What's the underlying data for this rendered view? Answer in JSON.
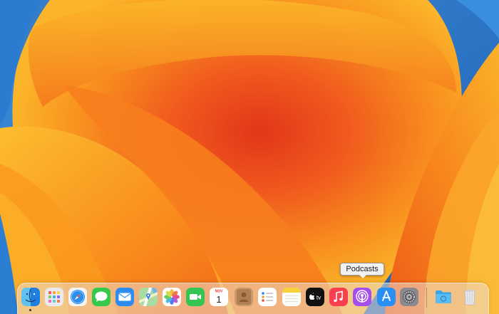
{
  "tooltip": {
    "text": "Podcasts"
  },
  "dock": {
    "apps": [
      {
        "name": "Finder",
        "icon": "finder-icon",
        "running": true
      },
      {
        "name": "Launchpad",
        "icon": "launchpad-icon",
        "running": false
      },
      {
        "name": "Safari",
        "icon": "safari-icon",
        "running": false
      },
      {
        "name": "Messages",
        "icon": "messages-icon",
        "running": false
      },
      {
        "name": "Mail",
        "icon": "mail-icon",
        "running": false
      },
      {
        "name": "Maps",
        "icon": "maps-icon",
        "running": false
      },
      {
        "name": "Photos",
        "icon": "photos-icon",
        "running": false
      },
      {
        "name": "FaceTime",
        "icon": "facetime-icon",
        "running": false
      },
      {
        "name": "Calendar",
        "icon": "calendar-icon",
        "running": false,
        "month": "NOV",
        "day": "1"
      },
      {
        "name": "Contacts",
        "icon": "contacts-icon",
        "running": false
      },
      {
        "name": "Reminders",
        "icon": "reminders-icon",
        "running": false
      },
      {
        "name": "Notes",
        "icon": "notes-icon",
        "running": false
      },
      {
        "name": "TV",
        "icon": "apple-tv-icon",
        "running": false,
        "label": "tv"
      },
      {
        "name": "Music",
        "icon": "music-icon",
        "running": false
      },
      {
        "name": "Podcasts",
        "icon": "podcasts-icon",
        "running": false
      },
      {
        "name": "App Store",
        "icon": "app-store-icon",
        "running": false
      },
      {
        "name": "System Settings",
        "icon": "system-settings-icon",
        "running": false
      },
      {
        "name": "Downloads",
        "icon": "folder-icon",
        "running": false
      },
      {
        "name": "Trash",
        "icon": "trash-icon",
        "running": false
      }
    ]
  },
  "colors": {
    "wallpaper_blue": "#1f6fc0",
    "wallpaper_orange": "#f7a21b",
    "wallpaper_red": "#e8431a"
  }
}
